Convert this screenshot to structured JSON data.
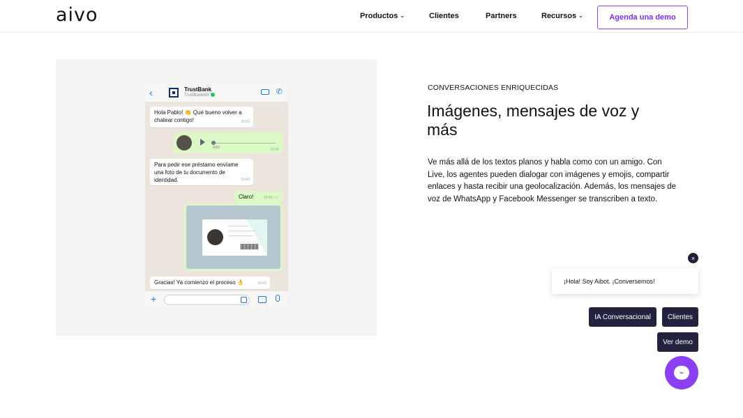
{
  "header": {
    "logo": "aivo",
    "nav": [
      {
        "label": "Productos",
        "has_dropdown": true
      },
      {
        "label": "Clientes",
        "has_dropdown": false
      },
      {
        "label": "Partners",
        "has_dropdown": false
      },
      {
        "label": "Recursos",
        "has_dropdown": true
      }
    ],
    "cta": "Agenda una demo"
  },
  "phone": {
    "contact_name": "TrustBank",
    "contact_handle": "TrustBankMX",
    "messages": [
      {
        "text": "Hola Pablo! 👏 Qué bueno volver a chatear contigo!",
        "time": "10:42"
      },
      {
        "voice_duration": "0:03",
        "time": "10:42"
      },
      {
        "text": "Para pedir ese préstamo envíame una foto de tu documento de identidad.",
        "time": "10:42"
      },
      {
        "text": "Claro!",
        "time": "10:42 ✓✓"
      },
      {
        "text": "Gracias! Ya comienzo el proceso 👌",
        "time": "10:42"
      }
    ]
  },
  "content": {
    "eyebrow": "CONVERSACIONES ENRIQUECIDAS",
    "title": "Imágenes, mensajes de voz y más",
    "body": "Ve más allá de los textos planos y habla como con un amigo. Con Live, los agentes pueden dialogar con imágenes y emojis, compartir enlaces y hasta recibir una geolocalización. Además, los mensajes de voz de WhatsApp y Facebook Messenger se transcriben a texto."
  },
  "chat_widget": {
    "close": "×",
    "greeting": "¡Hola! Soy Aibot. ¡Conversemos!",
    "options": [
      "IA Conversacional",
      "Clientes",
      "Ver demo"
    ]
  },
  "colors": {
    "accent": "#8a3ff2",
    "chip_bg": "#23233f",
    "whatsapp_out": "#dcf8c6"
  }
}
